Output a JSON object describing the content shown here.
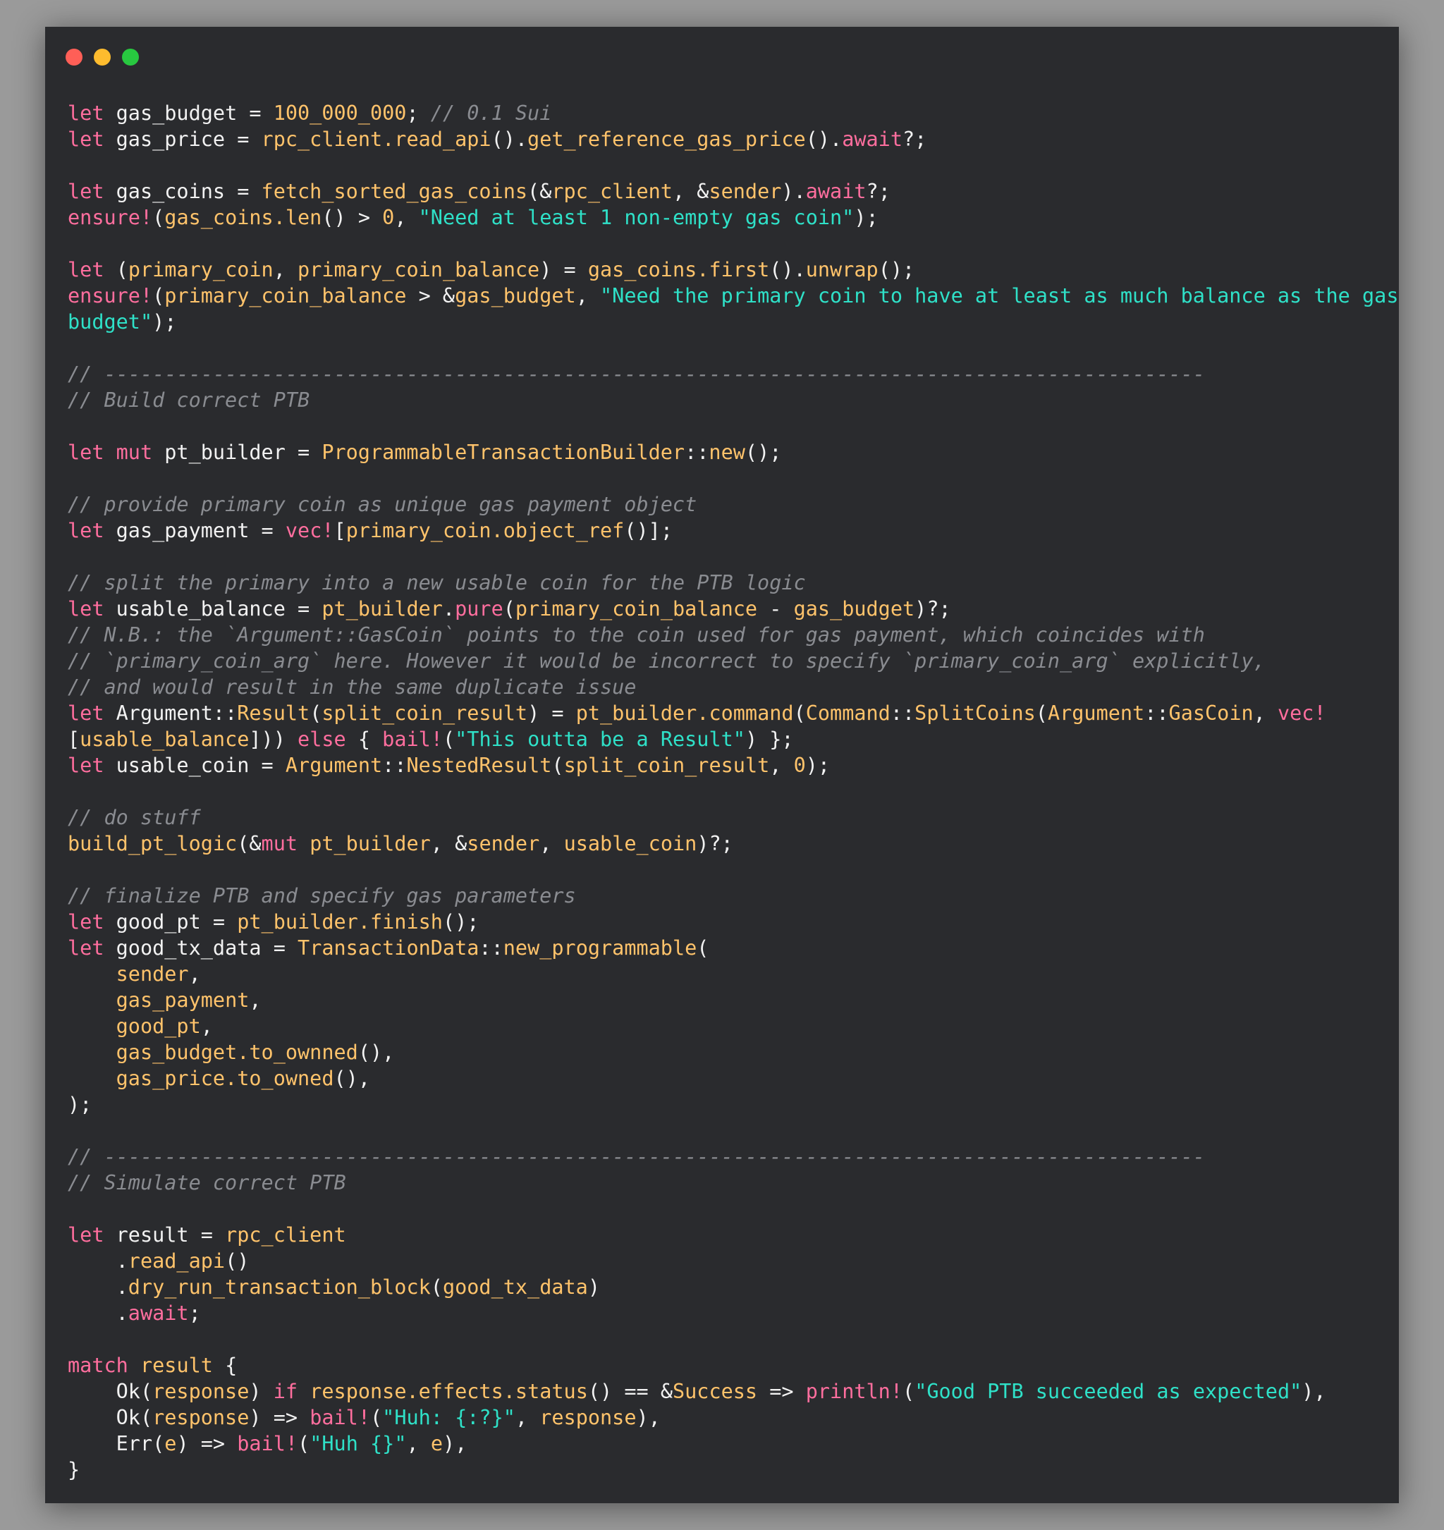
{
  "window": {
    "buttons": [
      {
        "name": "close",
        "color": "#ff5f57"
      },
      {
        "name": "minimize",
        "color": "#febc2e"
      },
      {
        "name": "maximize",
        "color": "#28c840"
      }
    ]
  },
  "colors": {
    "background": "#2a2b2e",
    "keyword": "#ff6e9e",
    "function": "#ffc36b",
    "string": "#2fe1c8",
    "comment": "#8a8c91",
    "plain": "#f2f2f2"
  },
  "code": {
    "language": "rust",
    "lines": [
      [
        [
          "k",
          "let"
        ],
        [
          "p",
          " gas_budget = "
        ],
        [
          "n",
          "100_000_000"
        ],
        [
          "p",
          "; "
        ],
        [
          "c",
          "// 0.1 Sui"
        ]
      ],
      [
        [
          "k",
          "let"
        ],
        [
          "p",
          " gas_price = "
        ],
        [
          "f",
          "rpc_client.read_api"
        ],
        [
          "p",
          "()."
        ],
        [
          "f",
          "get_reference_gas_price"
        ],
        [
          "p",
          "()."
        ],
        [
          "k",
          "await"
        ],
        [
          "p",
          "?;"
        ]
      ],
      [],
      [
        [
          "k",
          "let"
        ],
        [
          "p",
          " gas_coins = "
        ],
        [
          "f",
          "fetch_sorted_gas_coins"
        ],
        [
          "p",
          "(&"
        ],
        [
          "f",
          "rpc_client"
        ],
        [
          "p",
          ", &"
        ],
        [
          "f",
          "sender"
        ],
        [
          "p",
          ")."
        ],
        [
          "k",
          "await"
        ],
        [
          "p",
          "?;"
        ]
      ],
      [
        [
          "k",
          "ensure!"
        ],
        [
          "p",
          "("
        ],
        [
          "f",
          "gas_coins.len"
        ],
        [
          "p",
          "() > "
        ],
        [
          "n",
          "0"
        ],
        [
          "p",
          ", "
        ],
        [
          "s",
          "\"Need at least 1 non-empty gas coin\""
        ],
        [
          "p",
          ");"
        ]
      ],
      [],
      [
        [
          "k",
          "let"
        ],
        [
          "p",
          " ("
        ],
        [
          "f",
          "primary_coin"
        ],
        [
          "p",
          ", "
        ],
        [
          "f",
          "primary_coin_balance"
        ],
        [
          "p",
          ") = "
        ],
        [
          "f",
          "gas_coins.first"
        ],
        [
          "p",
          "()."
        ],
        [
          "f",
          "unwrap"
        ],
        [
          "p",
          "();"
        ]
      ],
      [
        [
          "k",
          "ensure!"
        ],
        [
          "p",
          "("
        ],
        [
          "f",
          "primary_coin_balance"
        ],
        [
          "p",
          " > &"
        ],
        [
          "f",
          "gas_budget"
        ],
        [
          "p",
          ", "
        ],
        [
          "s",
          "\"Need the primary coin to have at least as much balance as the gas"
        ]
      ],
      [
        [
          "s",
          "budget\""
        ],
        [
          "p",
          ");"
        ]
      ],
      [],
      [
        [
          "c",
          "// -------------------------------------------------------------------------------------------"
        ]
      ],
      [
        [
          "c",
          "// Build correct PTB"
        ]
      ],
      [],
      [
        [
          "k",
          "let mut"
        ],
        [
          "p",
          " pt_builder = "
        ],
        [
          "f",
          "ProgrammableTransactionBuilder"
        ],
        [
          "p",
          "::"
        ],
        [
          "f",
          "new"
        ],
        [
          "p",
          "();"
        ]
      ],
      [],
      [
        [
          "c",
          "// provide primary coin as unique gas payment object"
        ]
      ],
      [
        [
          "k",
          "let"
        ],
        [
          "p",
          " gas_payment = "
        ],
        [
          "k",
          "vec!"
        ],
        [
          "p",
          "["
        ],
        [
          "f",
          "primary_coin.object_ref"
        ],
        [
          "p",
          "()];"
        ]
      ],
      [],
      [
        [
          "c",
          "// split the primary into a new usable coin for the PTB logic"
        ]
      ],
      [
        [
          "k",
          "let"
        ],
        [
          "p",
          " usable_balance = "
        ],
        [
          "f",
          "pt_builder"
        ],
        [
          "p",
          "."
        ],
        [
          "k",
          "pure"
        ],
        [
          "p",
          "("
        ],
        [
          "f",
          "primary_coin_balance"
        ],
        [
          "p",
          " - "
        ],
        [
          "f",
          "gas_budget"
        ],
        [
          "p",
          ")?;"
        ]
      ],
      [
        [
          "c",
          "// N.B.: the `Argument::GasCoin` points to the coin used for gas payment, which coincides with"
        ]
      ],
      [
        [
          "c",
          "// `primary_coin_arg` here. However it would be incorrect to specify `primary_coin_arg` explicitly,"
        ]
      ],
      [
        [
          "c",
          "// and would result in the same duplicate issue"
        ]
      ],
      [
        [
          "k",
          "let"
        ],
        [
          "p",
          " Argument::"
        ],
        [
          "f",
          "Result"
        ],
        [
          "p",
          "("
        ],
        [
          "f",
          "split_coin_result"
        ],
        [
          "p",
          ") = "
        ],
        [
          "f",
          "pt_builder.command"
        ],
        [
          "p",
          "("
        ],
        [
          "f",
          "Command"
        ],
        [
          "p",
          "::"
        ],
        [
          "f",
          "SplitCoins"
        ],
        [
          "p",
          "("
        ],
        [
          "f",
          "Argument"
        ],
        [
          "p",
          "::"
        ],
        [
          "f",
          "GasCoin"
        ],
        [
          "p",
          ", "
        ],
        [
          "k",
          "vec!"
        ]
      ],
      [
        [
          "p",
          "["
        ],
        [
          "f",
          "usable_balance"
        ],
        [
          "p",
          "])) "
        ],
        [
          "k",
          "else"
        ],
        [
          "p",
          " { "
        ],
        [
          "k",
          "bail!"
        ],
        [
          "p",
          "("
        ],
        [
          "s",
          "\"This outta be a Result\""
        ],
        [
          "p",
          ") };"
        ]
      ],
      [
        [
          "k",
          "let"
        ],
        [
          "p",
          " usable_coin = "
        ],
        [
          "f",
          "Argument"
        ],
        [
          "p",
          "::"
        ],
        [
          "f",
          "NestedResult"
        ],
        [
          "p",
          "("
        ],
        [
          "f",
          "split_coin_result"
        ],
        [
          "p",
          ", "
        ],
        [
          "n",
          "0"
        ],
        [
          "p",
          ");"
        ]
      ],
      [],
      [
        [
          "c",
          "// do stuff"
        ]
      ],
      [
        [
          "f",
          "build_pt_logic"
        ],
        [
          "p",
          "(&"
        ],
        [
          "k",
          "mut"
        ],
        [
          "p",
          " "
        ],
        [
          "f",
          "pt_builder"
        ],
        [
          "p",
          ", &"
        ],
        [
          "f",
          "sender"
        ],
        [
          "p",
          ", "
        ],
        [
          "f",
          "usable_coin"
        ],
        [
          "p",
          ")?;"
        ]
      ],
      [],
      [
        [
          "c",
          "// finalize PTB and specify gas parameters"
        ]
      ],
      [
        [
          "k",
          "let"
        ],
        [
          "p",
          " good_pt = "
        ],
        [
          "f",
          "pt_builder.finish"
        ],
        [
          "p",
          "();"
        ]
      ],
      [
        [
          "k",
          "let"
        ],
        [
          "p",
          " good_tx_data = "
        ],
        [
          "f",
          "TransactionData"
        ],
        [
          "p",
          "::"
        ],
        [
          "f",
          "new_programmable"
        ],
        [
          "p",
          "("
        ]
      ],
      [
        [
          "p",
          "    "
        ],
        [
          "f",
          "sender"
        ],
        [
          "p",
          ","
        ]
      ],
      [
        [
          "p",
          "    "
        ],
        [
          "f",
          "gas_payment"
        ],
        [
          "p",
          ","
        ]
      ],
      [
        [
          "p",
          "    "
        ],
        [
          "f",
          "good_pt"
        ],
        [
          "p",
          ","
        ]
      ],
      [
        [
          "p",
          "    "
        ],
        [
          "f",
          "gas_budget.to_ownned"
        ],
        [
          "p",
          "(),"
        ]
      ],
      [
        [
          "p",
          "    "
        ],
        [
          "f",
          "gas_price.to_owned"
        ],
        [
          "p",
          "(),"
        ]
      ],
      [
        [
          "p",
          ");"
        ]
      ],
      [],
      [
        [
          "c",
          "// -------------------------------------------------------------------------------------------"
        ]
      ],
      [
        [
          "c",
          "// Simulate correct PTB"
        ]
      ],
      [],
      [
        [
          "k",
          "let"
        ],
        [
          "p",
          " result = "
        ],
        [
          "f",
          "rpc_client"
        ]
      ],
      [
        [
          "p",
          "    ."
        ],
        [
          "f",
          "read_api"
        ],
        [
          "p",
          "()"
        ]
      ],
      [
        [
          "p",
          "    ."
        ],
        [
          "f",
          "dry_run_transaction_block"
        ],
        [
          "p",
          "("
        ],
        [
          "f",
          "good_tx_data"
        ],
        [
          "p",
          ")"
        ]
      ],
      [
        [
          "p",
          "    ."
        ],
        [
          "k",
          "await"
        ],
        [
          "p",
          ";"
        ]
      ],
      [],
      [
        [
          "k",
          "match"
        ],
        [
          "p",
          " "
        ],
        [
          "f",
          "result"
        ],
        [
          "p",
          " {"
        ]
      ],
      [
        [
          "p",
          "    Ok("
        ],
        [
          "f",
          "response"
        ],
        [
          "p",
          ") "
        ],
        [
          "k",
          "if"
        ],
        [
          "p",
          " "
        ],
        [
          "f",
          "response.effects.status"
        ],
        [
          "p",
          "() == &"
        ],
        [
          "f",
          "Success"
        ],
        [
          "p",
          " => "
        ],
        [
          "k",
          "println!"
        ],
        [
          "p",
          "("
        ],
        [
          "s",
          "\"Good PTB succeeded as expected\""
        ],
        [
          "p",
          "),"
        ]
      ],
      [
        [
          "p",
          "    Ok("
        ],
        [
          "f",
          "response"
        ],
        [
          "p",
          ") => "
        ],
        [
          "k",
          "bail!"
        ],
        [
          "p",
          "("
        ],
        [
          "s",
          "\"Huh: {:?}\""
        ],
        [
          "p",
          ", "
        ],
        [
          "f",
          "response"
        ],
        [
          "p",
          "),"
        ]
      ],
      [
        [
          "p",
          "    Err("
        ],
        [
          "f",
          "e"
        ],
        [
          "p",
          ") => "
        ],
        [
          "k",
          "bail!"
        ],
        [
          "p",
          "("
        ],
        [
          "s",
          "\"Huh {}\""
        ],
        [
          "p",
          ", "
        ],
        [
          "f",
          "e"
        ],
        [
          "p",
          "),"
        ]
      ],
      [
        [
          "p",
          "}"
        ]
      ]
    ]
  }
}
